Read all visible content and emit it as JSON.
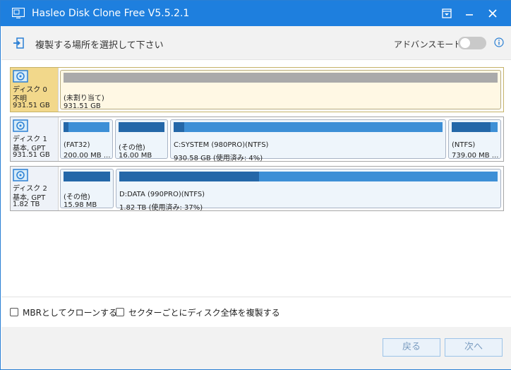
{
  "window": {
    "title": "Hasleo Disk Clone Free V5.5.2.1"
  },
  "header": {
    "step_title": "複製する場所を選択して下さい",
    "advanced_mode_label": "アドバンスモード",
    "advanced_mode_on": false
  },
  "disks": [
    {
      "line1": "ディスク 0",
      "line2": "不明",
      "line3": "931.51 GB",
      "selected": true,
      "partitions": [
        {
          "name": "(未割り当て)",
          "size": "931.51 GB",
          "used": 0,
          "unallocated": true
        }
      ]
    },
    {
      "line1": "ディスク 1",
      "line2": "基本, GPT",
      "line3": "931.51 GB",
      "selected": false,
      "partitions": [
        {
          "name": "(FAT32)",
          "size": "200.00 MB ...",
          "used": 0.1
        },
        {
          "name": "(その他)",
          "size": "16.00 MB",
          "used": 1.0
        },
        {
          "name": "C:SYSTEM (980PRO)(NTFS)",
          "size": "930.58 GB (使用済み: 4%)",
          "used": 0.04
        },
        {
          "name": "(NTFS)",
          "size": "739.00 MB ...",
          "used": 0.85
        }
      ]
    },
    {
      "line1": "ディスク 2",
      "line2": "基本, GPT",
      "line3": "1.82 TB",
      "selected": false,
      "partitions": [
        {
          "name": "(その他)",
          "size": "15.98 MB",
          "used": 1.0
        },
        {
          "name": "D:DATA (990PRO)(NTFS)",
          "size": "1.82 TB (使用済み: 37%)",
          "used": 0.37
        }
      ]
    }
  ],
  "options": {
    "mbr_label": "MBRとしてクローンする",
    "mbr_checked": false,
    "sector_label": "セクターごとにディスク全体を複製する",
    "sector_checked": false
  },
  "footer": {
    "back_label": "戻る",
    "next_label": "次へ"
  },
  "colors": {
    "titlebar": "#1e7fde",
    "selected_disk": "#f2d88b",
    "bar": "#3d8fd6",
    "bar_used": "#2467a8",
    "unallocated": "#aaaaaa"
  }
}
